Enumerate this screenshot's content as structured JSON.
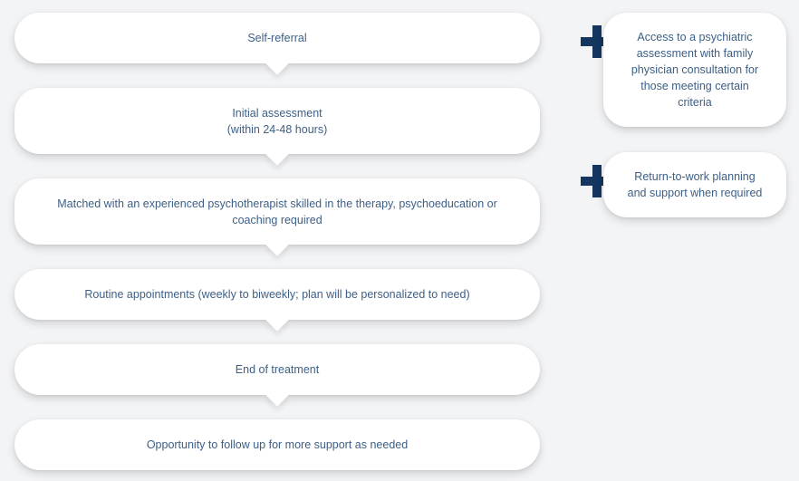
{
  "flow": {
    "steps": [
      {
        "label": "Self-referral"
      },
      {
        "label": "Initial assessment\n(within 24-48 hours)"
      },
      {
        "label": "Matched with an experienced psychotherapist skilled in the therapy, psychoeducation or\ncoaching required"
      },
      {
        "label": "Routine appointments (weekly to biweekly; plan will be personalized to need)"
      },
      {
        "label": "End of treatment"
      },
      {
        "label": "Opportunity to follow up for more support as needed"
      }
    ]
  },
  "extras": {
    "items": [
      {
        "icon": "plus-icon",
        "label": "Access to a psychiatric\nassessment with family\nphysician consultation for\nthose meeting certain\ncriteria"
      },
      {
        "icon": "plus-icon",
        "label": "Return-to-work planning\nand support when required"
      }
    ]
  },
  "colors": {
    "background": "#f3f4f6",
    "card": "#ffffff",
    "text": "#3d5f86",
    "plus": "#14365f"
  }
}
